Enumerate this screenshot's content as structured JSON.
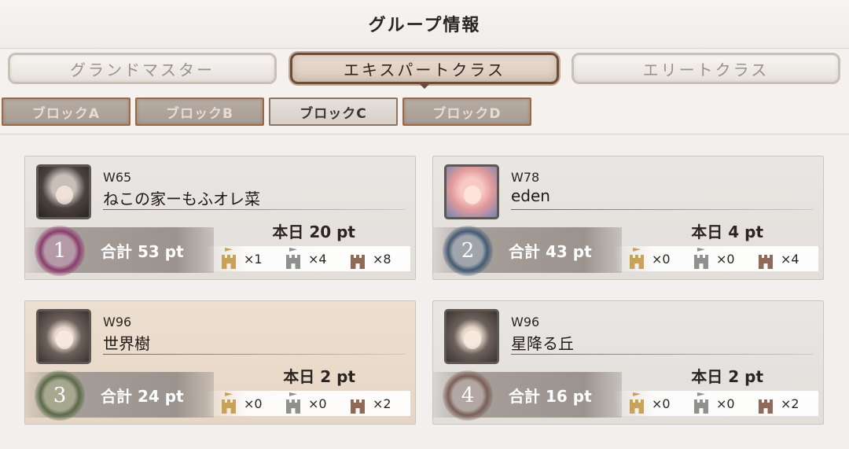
{
  "title": "グループ情報",
  "class_tabs": [
    {
      "label": "グランドマスター",
      "active": false
    },
    {
      "label": "エキスパートクラス",
      "active": true
    },
    {
      "label": "エリートクラス",
      "active": false
    }
  ],
  "block_tabs": [
    {
      "label": "ブロックA",
      "active": false
    },
    {
      "label": "ブロックB",
      "active": false
    },
    {
      "label": "ブロックC",
      "active": true
    },
    {
      "label": "ブロックD",
      "active": false
    }
  ],
  "groups": [
    {
      "rank": "1",
      "world": "W65",
      "name": "ねこの家ーもふオレ菜",
      "today": "本日 20 pt",
      "total": "合計 53 pt",
      "gold": "×1",
      "silver": "×4",
      "bronze": "×8"
    },
    {
      "rank": "2",
      "world": "W78",
      "name": "eden",
      "today": "本日 4 pt",
      "total": "合計 43 pt",
      "gold": "×0",
      "silver": "×0",
      "bronze": "×4"
    },
    {
      "rank": "3",
      "world": "W96",
      "name": "世界樹",
      "today": "本日 2 pt",
      "total": "合計 24 pt",
      "gold": "×0",
      "silver": "×0",
      "bronze": "×2"
    },
    {
      "rank": "4",
      "world": "W96",
      "name": "星降る丘",
      "today": "本日 2 pt",
      "total": "合計 16 pt",
      "gold": "×0",
      "silver": "×0",
      "bronze": "×2"
    }
  ],
  "icons": {
    "gold": "gold-tower-icon",
    "silver": "silver-tower-icon",
    "bronze": "bronze-tower-icon"
  },
  "colors": {
    "active_tab_border": "#6b4d3c",
    "block_tab_border": "#a0683f",
    "highlight_card": "#eddfd0"
  }
}
